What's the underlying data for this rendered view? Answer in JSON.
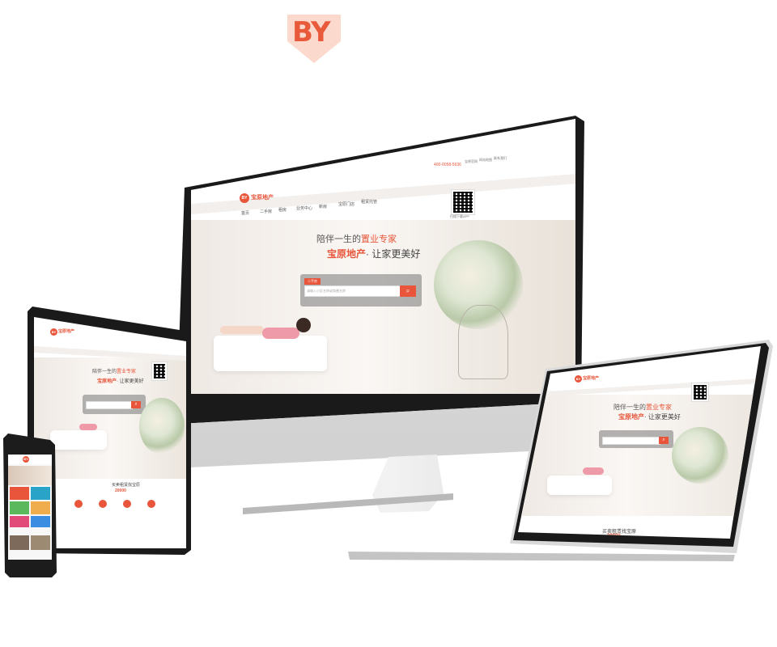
{
  "logo": {
    "text": "BY",
    "color": "#e85a3a"
  },
  "site": {
    "brand_name": "宝原地产",
    "brand_mark": "BY",
    "hotline": "400-0058-5636",
    "top_links": [
      "宝原官网",
      "网站地图",
      "联系我们"
    ],
    "nav_items": [
      "首页",
      "二手房",
      "租房",
      "业务中心",
      "新房",
      "宝原门店",
      "租赁托管"
    ],
    "tagline_pre": "陪伴一生的",
    "tagline_highlight": "置业专家",
    "tagline2_brand": "宝原地产",
    "tagline2_rest": "· 让家更美好",
    "search_tabs": [
      "二手房",
      "租房",
      "业务中心",
      "新房",
      "置业顾问",
      "宝原门店"
    ],
    "search_active_tab": "二手房",
    "search_placeholder": "请输入小区名称或商圈名称",
    "qr_caption": "扫描下载APP",
    "landing_section_title": "买卖租赁找宝原",
    "landing_section_number": "20000"
  },
  "colors": {
    "accent": "#e8553a",
    "bezel": "#1c1c1c",
    "silver": "#d8d8d8"
  },
  "icons": [
    "phone-icon",
    "search-icon",
    "qr-code-icon"
  ]
}
